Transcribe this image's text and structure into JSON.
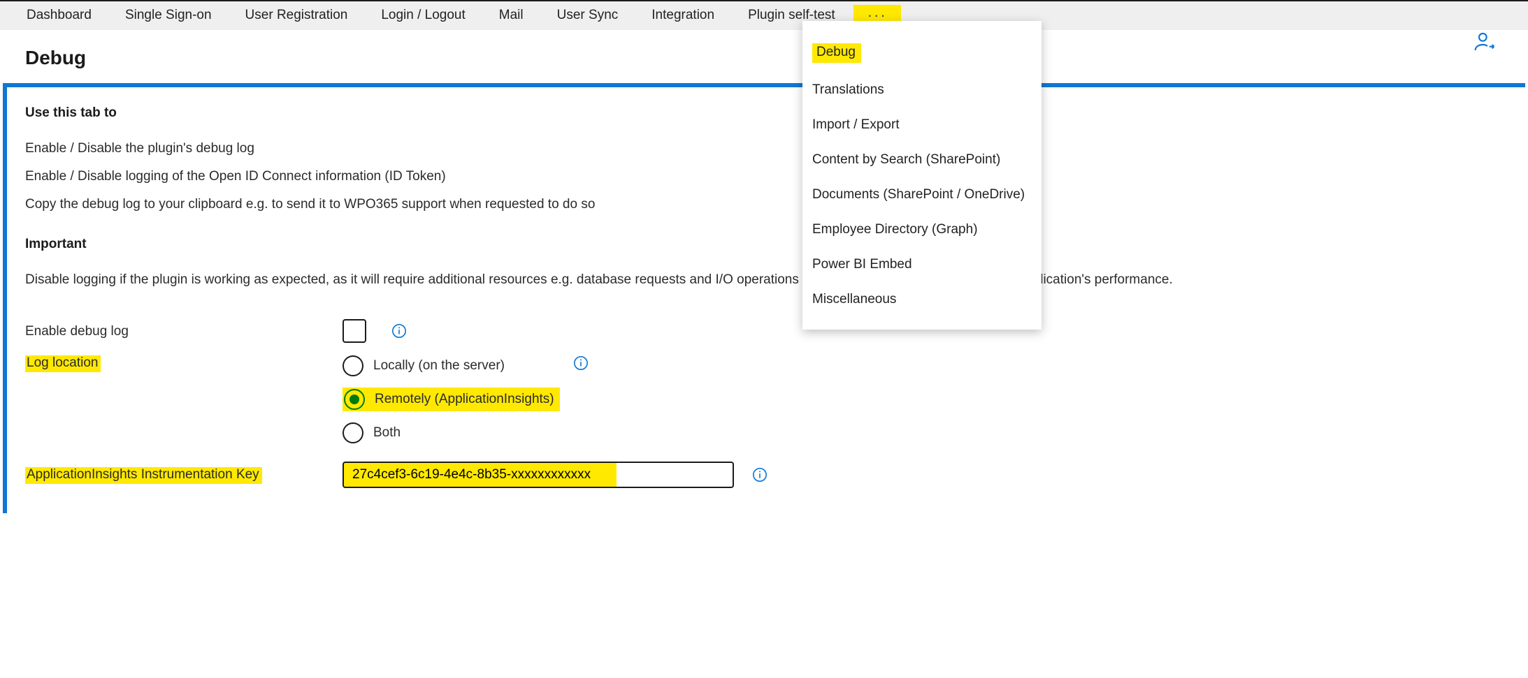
{
  "tabs": [
    {
      "label": "Dashboard"
    },
    {
      "label": "Single Sign-on"
    },
    {
      "label": "User Registration"
    },
    {
      "label": "Login / Logout"
    },
    {
      "label": "Mail"
    },
    {
      "label": "User Sync"
    },
    {
      "label": "Integration"
    },
    {
      "label": "Plugin self-test"
    }
  ],
  "more_glyph": "···",
  "dropdown": {
    "items": [
      {
        "label": "Debug",
        "highlight": true
      },
      {
        "label": "Translations"
      },
      {
        "label": "Import / Export"
      },
      {
        "label": "Content by Search (SharePoint)"
      },
      {
        "label": "Documents (SharePoint / OneDrive)"
      },
      {
        "label": "Employee Directory (Graph)"
      },
      {
        "label": "Power BI Embed"
      },
      {
        "label": "Miscellaneous"
      }
    ]
  },
  "page": {
    "title": "Debug",
    "section_heading": "Use this tab to",
    "bullets": [
      "Enable / Disable the plugin's debug log",
      "Enable / Disable logging of the Open ID Connect information (ID Token)",
      "Copy the debug log to your clipboard e.g. to send it to WPO365 support when requested to do so"
    ],
    "important_heading": "Important",
    "important_text": "Disable logging if the plugin is working as expected, as it will require additional resources e.g. database requests and I/O operations and thus can negatively impact your application's performance."
  },
  "form": {
    "enable_debug_label": "Enable debug log",
    "log_location_label": "Log location",
    "radios": [
      {
        "label": "Locally (on the server)",
        "selected": false
      },
      {
        "label": "Remotely (ApplicationInsights)",
        "selected": true,
        "highlight": true
      },
      {
        "label": "Both",
        "selected": false
      }
    ],
    "instrumentation_key_label": "ApplicationInsights Instrumentation Key",
    "instrumentation_key_value": "27c4cef3-6c19-4e4c-8b35-xxxxxxxxxxxx"
  }
}
